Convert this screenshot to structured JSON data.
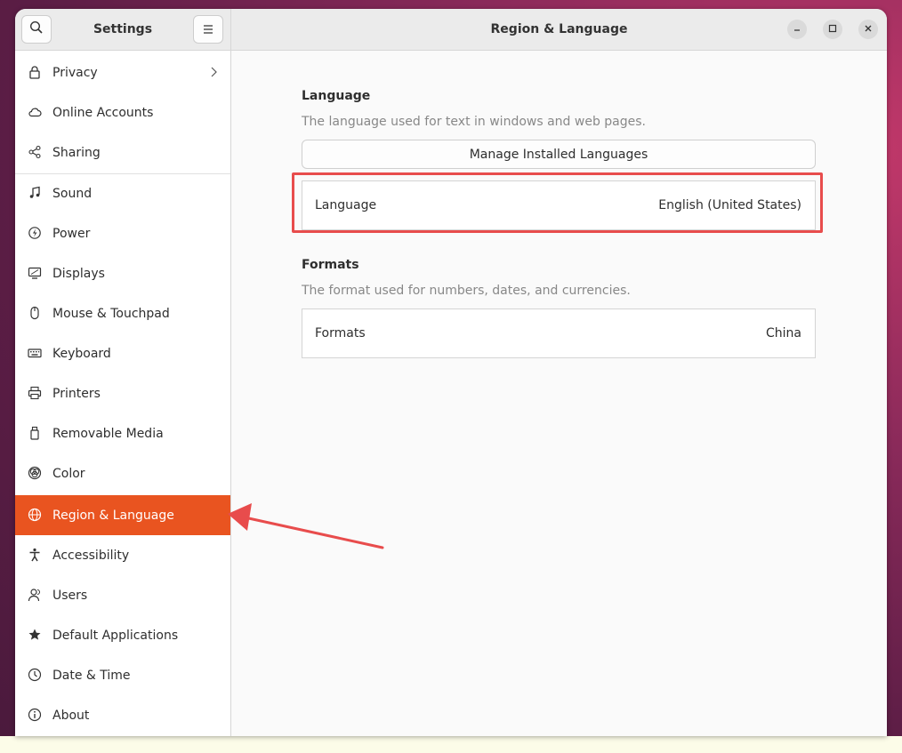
{
  "sidebar_header": {
    "title": "Settings"
  },
  "main_header": {
    "title": "Region & Language"
  },
  "sidebar": {
    "items": [
      {
        "id": "privacy",
        "label": "Privacy"
      },
      {
        "id": "online-accounts",
        "label": "Online Accounts"
      },
      {
        "id": "sharing",
        "label": "Sharing"
      },
      {
        "id": "sound",
        "label": "Sound"
      },
      {
        "id": "power",
        "label": "Power"
      },
      {
        "id": "displays",
        "label": "Displays"
      },
      {
        "id": "mouse-touchpad",
        "label": "Mouse & Touchpad"
      },
      {
        "id": "keyboard",
        "label": "Keyboard"
      },
      {
        "id": "printers",
        "label": "Printers"
      },
      {
        "id": "removable-media",
        "label": "Removable Media"
      },
      {
        "id": "color",
        "label": "Color"
      },
      {
        "id": "region-language",
        "label": "Region & Language",
        "active": true
      },
      {
        "id": "accessibility",
        "label": "Accessibility"
      },
      {
        "id": "users",
        "label": "Users"
      },
      {
        "id": "default-applications",
        "label": "Default Applications"
      },
      {
        "id": "date-time",
        "label": "Date & Time"
      },
      {
        "id": "about",
        "label": "About"
      }
    ]
  },
  "language_section": {
    "title": "Language",
    "description": "The language used for text in windows and web pages.",
    "manage_button": "Manage Installed Languages",
    "row_label": "Language",
    "row_value": "English (United States)"
  },
  "formats_section": {
    "title": "Formats",
    "description": "The format used for numbers, dates, and currencies.",
    "row_label": "Formats",
    "row_value": "China"
  },
  "colors": {
    "accent": "#e95420",
    "annotation": "#e84c4c"
  }
}
